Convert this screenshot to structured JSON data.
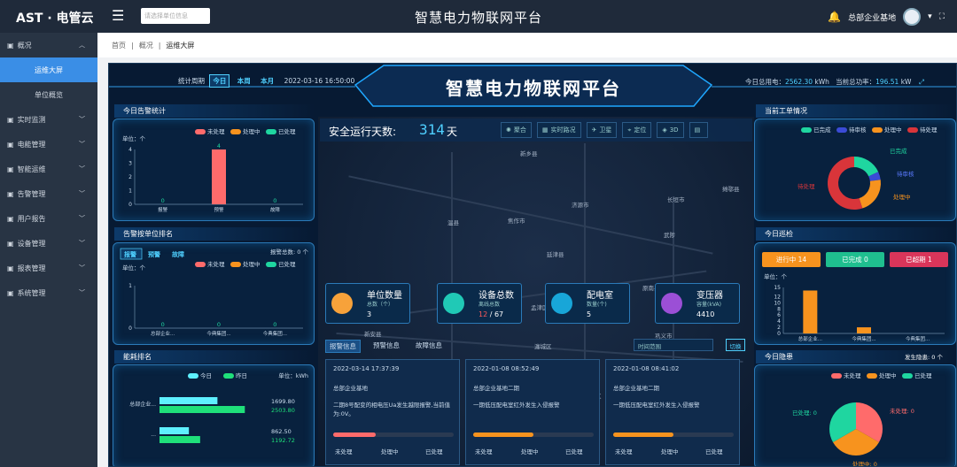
{
  "app": {
    "logo": "电管云",
    "logo_prefix": "AST ·",
    "search_placeholder": "请选择单位信息",
    "title": "智慧电力物联网平台",
    "user": "总部企业基地"
  },
  "sidebar": {
    "items": [
      {
        "label": "概况",
        "chev": "^"
      },
      {
        "label": "运维大屏",
        "sub": true,
        "active": true
      },
      {
        "label": "单位概览",
        "sub": true
      },
      {
        "label": "实时监测",
        "chev": "v"
      },
      {
        "label": "电能管理",
        "chev": "v"
      },
      {
        "label": "智能运维",
        "chev": "v"
      },
      {
        "label": "告警管理",
        "chev": "v"
      },
      {
        "label": "用户报告",
        "chev": "v"
      },
      {
        "label": "设备管理",
        "chev": "v"
      },
      {
        "label": "报表管理",
        "chev": "v"
      },
      {
        "label": "系统管理",
        "chev": "v"
      }
    ]
  },
  "breadcrumb": {
    "home": "首页",
    "level1": "概况",
    "current": "运维大屏"
  },
  "screen": {
    "title": "智慧电力物联网平台",
    "period_label": "统计周期",
    "period_today": "今日",
    "period_week": "本周",
    "period_month": "本月",
    "datetime": "2022-03-16 16:50:00",
    "power_label": "今日总用电：",
    "power_value": "2562.30",
    "power_unit": "kWh",
    "load_label": "当前总功率：",
    "load_value": "196.51",
    "load_unit": "kW",
    "safe_label": "安全运行天数:",
    "safe_days": "314",
    "safe_unit": "天",
    "map_buttons": [
      "聚合",
      "实时路况",
      "卫星",
      "定位",
      "3D",
      ""
    ],
    "cities": [
      "新乡县",
      "济源市",
      "长垣市",
      "摊鄂县",
      "温县",
      "焦作市",
      "延津县",
      "武陟",
      "原阳县",
      "孟津区",
      "原南县",
      "新安县",
      "巩义市",
      "瀍城区",
      "洛",
      "偃师区",
      "登封区",
      "新郑区",
      "唐村"
    ],
    "cards": [
      {
        "title": "单位数量",
        "sub": "总数（个）",
        "value": "3",
        "color": "#f7a23a"
      },
      {
        "title": "设备总数",
        "sub": "离线总数",
        "value": "12",
        "value2": "/ 67",
        "color": "#20c9b6"
      },
      {
        "title": "配电室",
        "sub": "数量(个)",
        "value": "5",
        "color": "#18a6d8"
      },
      {
        "title": "变压器",
        "sub": "容量(kVA)",
        "value": "4410",
        "color": "#9b4fd6"
      }
    ],
    "tabs": {
      "t1": "报警信息",
      "t2": "预警信息",
      "t3": "故障信息",
      "range": "时间范围",
      "switch": "切换"
    },
    "events": [
      {
        "time": "2022-03-14 17:37:39",
        "name": "总部企业基地",
        "desc": "二期8号配变的相电压Ua发生越限报警,当前值为:0V。",
        "s1": "未处理",
        "s2": "处理中",
        "s3": "已处理",
        "fill": 0.35,
        "fillcolor": "#ff6b6b"
      },
      {
        "time": "2022-01-08 08:52:49",
        "name": "总部企业基地二期",
        "desc": "一期低压配电室红外发生入侵报警",
        "s1": "未处理",
        "s2": "处理中",
        "s3": "已处理",
        "fill": 0.5,
        "fillcolor": "#f7931e"
      },
      {
        "time": "2022-01-08 08:41:02",
        "name": "总部企业基地二期",
        "desc": "一期低压配电室红外发生入侵报警",
        "s1": "未处理",
        "s2": "处理中",
        "s3": "已处理",
        "fill": 0.5,
        "fillcolor": "#f7931e"
      }
    ],
    "left": {
      "p1": {
        "title": "今日告警统计",
        "unit": "单位：个",
        "legend": [
          "未处理",
          "处理中",
          "已处理"
        ],
        "chart_data": {
          "type": "bar",
          "categories": [
            "报警",
            "预警",
            "故障"
          ],
          "values": [
            0,
            4,
            0
          ],
          "ylim": [
            0,
            4
          ],
          "yticks": [
            "0",
            "1",
            "2",
            "3",
            "4"
          ]
        }
      },
      "p2": {
        "title": "告警按单位排名",
        "tabs": [
          "报警",
          "预警",
          "故障"
        ],
        "count_label": "报警总数: 0 个",
        "unit": "单位：个",
        "legend": [
          "未处理",
          "处理中",
          "已处理"
        ],
        "chart_data": {
          "type": "bar",
          "categories": [
            "总部企业...",
            "今典集团...",
            "今典集团..."
          ],
          "values": [
            0,
            0,
            0
          ],
          "ylim": [
            0,
            1
          ],
          "yticks": [
            "0",
            "1"
          ]
        }
      },
      "p3": {
        "title": "能耗排名",
        "legend": [
          "今日",
          "昨日"
        ],
        "unit": "单位：kWh",
        "chart_data": {
          "type": "bar",
          "categories": [
            "总部企业...",
            "..."
          ],
          "series": [
            {
              "name": "今日",
              "values": [
                1699.8,
                862.5
              ]
            },
            {
              "name": "昨日",
              "values": [
                2503.8,
                1192.72
              ]
            }
          ]
        }
      }
    },
    "right": {
      "p1": {
        "title": "当前工单情况",
        "legend": [
          "已完成",
          "待审核",
          "处理中",
          "待处理"
        ],
        "chart_data": {
          "type": "pie",
          "labels": [
            "已完成",
            "待审核",
            "处理中",
            "待处理"
          ],
          "values": [
            18,
            5,
            22,
            55
          ],
          "colors": [
            "#1fd6a0",
            "#3b4bd6",
            "#f7931e",
            "#d9353a"
          ]
        }
      },
      "p2": {
        "title": "今日巡检",
        "pills": [
          {
            "label": "进行中 14",
            "color": "#f7931e"
          },
          {
            "label": "已完成 0",
            "color": "#1fbf8f"
          },
          {
            "label": "已超期 1",
            "color": "#d9355a"
          }
        ],
        "unit": "单位：个",
        "chart_data": {
          "type": "bar",
          "categories": [
            "总部企业...",
            "今典集团...",
            "今典集团..."
          ],
          "values": [
            14,
            2,
            0
          ],
          "ylim": [
            0,
            15
          ],
          "yticks": [
            "0",
            "2",
            "4",
            "6",
            "8",
            "10",
            "12",
            "15"
          ]
        }
      },
      "p3": {
        "title": "今日隐患",
        "count_label": "发生隐患: 0 个",
        "legend": [
          "未处理",
          "处理中",
          "已处理"
        ],
        "labels": [
          "未处理: 0",
          "已处理: 0",
          "处理中: 0"
        ],
        "chart_data": {
          "type": "pie",
          "labels": [
            "未处理",
            "处理中",
            "已处理"
          ],
          "values": [
            1,
            1,
            1
          ],
          "colors": [
            "#ff6b6b",
            "#f7931e",
            "#1fd6a0"
          ]
        }
      }
    }
  }
}
